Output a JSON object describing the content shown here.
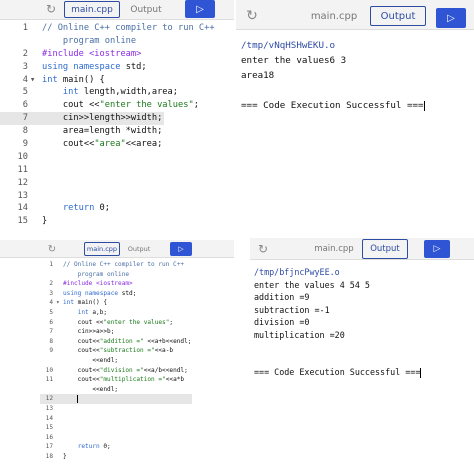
{
  "icons": {
    "reload": "reload-icon",
    "run": "play-icon"
  },
  "colors": {
    "accent": "#2f55d4",
    "keyword": "#2e6bd0",
    "string": "#1a7a1a"
  },
  "panels": [
    {
      "tabs": {
        "code": "main.cpp",
        "output": "Output"
      },
      "run_glyph": "▷",
      "code": [
        {
          "n": "1",
          "t": "// Online C++ compiler to run C++",
          "cls": "cm"
        },
        {
          "n": "",
          "t": "    program online",
          "cls": "cm"
        },
        {
          "n": "2",
          "t": "#include <iostream>",
          "cls": "pp"
        },
        {
          "n": "3",
          "t": "using namespace std;"
        },
        {
          "n": "4",
          "fold": "▾",
          "t": "int main() {"
        },
        {
          "n": "5",
          "t": "    int length,width,area;"
        },
        {
          "n": "6",
          "t": "    cout <<\"enter the values\";"
        },
        {
          "n": "7",
          "t": "    cin>>length>>width;",
          "hl": true
        },
        {
          "n": "8",
          "t": "    area=length *width;"
        },
        {
          "n": "9",
          "t": "    cout<<\"area\"<<area;"
        },
        {
          "n": "10",
          "t": ""
        },
        {
          "n": "11",
          "t": ""
        },
        {
          "n": "12",
          "t": ""
        },
        {
          "n": "13",
          "t": ""
        },
        {
          "n": "14",
          "t": "    return 0;"
        },
        {
          "n": "15",
          "t": "}"
        }
      ]
    },
    {
      "tabs": {
        "code": "main.cpp",
        "output": "Output"
      },
      "run_glyph": "▷",
      "output": [
        {
          "t": "/tmp/vNqHSHwEKU.o",
          "cls": "out-path"
        },
        {
          "t": "enter the values6 3"
        },
        {
          "t": "area18"
        },
        {
          "t": ""
        },
        {
          "t": "=== Code Execution Successful ===",
          "cursor": true
        }
      ]
    },
    {
      "tabs": {
        "code": "main.cpp",
        "output": "Output"
      },
      "run_glyph": "▷",
      "code": [
        {
          "n": "1",
          "t": "// Online C++ compiler to run C++",
          "cls": "cm"
        },
        {
          "n": "",
          "t": "    program online",
          "cls": "cm"
        },
        {
          "n": "2",
          "t": "#include <iostream>",
          "cls": "pp"
        },
        {
          "n": "3",
          "t": "using namespace std;"
        },
        {
          "n": "4",
          "fold": "▾",
          "t": "int main() {"
        },
        {
          "n": "5",
          "t": "    int a,b;"
        },
        {
          "n": "6",
          "t": "    cout <<\"enter the values\";"
        },
        {
          "n": "7",
          "t": "    cin>>a>>b;"
        },
        {
          "n": "8",
          "t": "    cout<<\"addition =\" <<a+b<<endl;"
        },
        {
          "n": "9",
          "t": "    cout<<\"subtraction =\"<<a-b"
        },
        {
          "n": "",
          "t": "        <<endl;"
        },
        {
          "n": "10",
          "t": "    cout<<\"division =\"<<a/b<<endl;"
        },
        {
          "n": "11",
          "t": "    cout<<\"multiplication =\"<<a*b"
        },
        {
          "n": "",
          "t": "        <<endl;"
        },
        {
          "n": "12",
          "t": "    ",
          "hl": true,
          "cursor": true
        },
        {
          "n": "13",
          "t": ""
        },
        {
          "n": "14",
          "t": ""
        },
        {
          "n": "15",
          "t": ""
        },
        {
          "n": "16",
          "t": ""
        },
        {
          "n": "17",
          "t": "    return 0;"
        },
        {
          "n": "18",
          "t": "}"
        }
      ]
    },
    {
      "tabs": {
        "code": "main.cpp",
        "output": "Output"
      },
      "run_glyph": "▷",
      "output": [
        {
          "t": "/tmp/bfjncPwyEE.o",
          "cls": "out-path"
        },
        {
          "t": "enter the values 4 54 5"
        },
        {
          "t": "addition =9"
        },
        {
          "t": "subtraction =-1"
        },
        {
          "t": "division =0"
        },
        {
          "t": "multiplication =20"
        },
        {
          "t": ""
        },
        {
          "t": ""
        },
        {
          "t": "=== Code Execution Successful ===",
          "cursor": true
        }
      ]
    }
  ]
}
